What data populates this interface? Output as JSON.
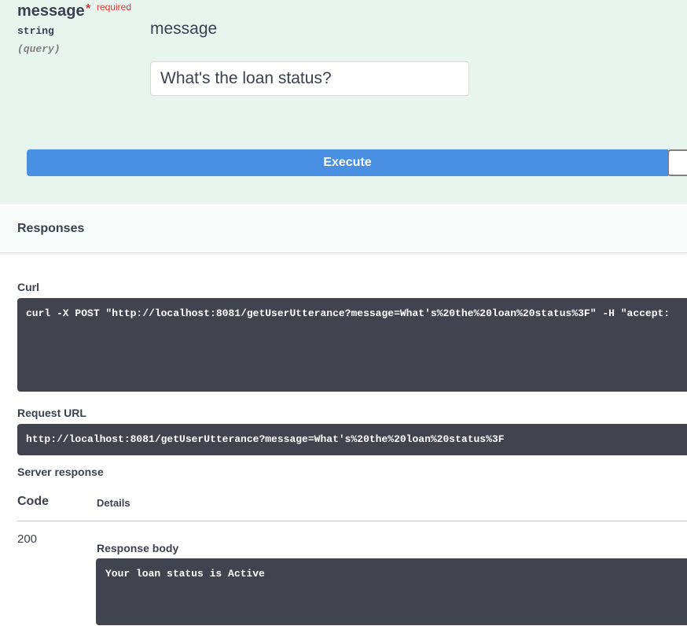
{
  "parameter": {
    "name": "message",
    "required_star": "*",
    "required_label": "required",
    "type": "string",
    "location": "(query)",
    "description": "message",
    "input_value": "What's the loan status?"
  },
  "execute": {
    "label": "Execute"
  },
  "responses": {
    "title": "Responses",
    "curl_label": "Curl",
    "curl_command": "curl -X POST \"http://localhost:8081/getUserUtterance?message=What's%20the%20loan%20status%3F\" -H \"accept: ",
    "request_url_label": "Request URL",
    "request_url": "http://localhost:8081/getUserUtterance?message=What's%20the%20loan%20status%3F",
    "server_response_label": "Server response",
    "table": {
      "code_header": "Code",
      "details_header": "Details",
      "rows": [
        {
          "code": "200",
          "body_label": "Response body",
          "body": "Your loan status is Active"
        }
      ]
    }
  },
  "colors": {
    "param_bg": "#e8f5ef",
    "execute_blue": "#4990e2",
    "required_red": "#e5322e",
    "code_bg": "#41444e"
  }
}
